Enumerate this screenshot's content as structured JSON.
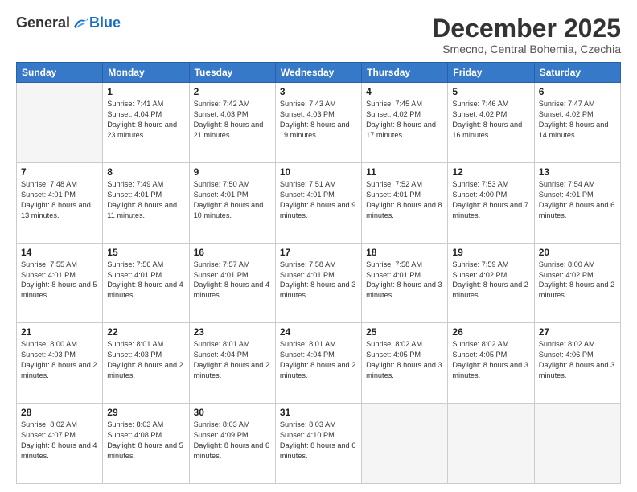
{
  "logo": {
    "general": "General",
    "blue": "Blue"
  },
  "title": {
    "month": "December 2025",
    "location": "Smecno, Central Bohemia, Czechia"
  },
  "weekdays": [
    "Sunday",
    "Monday",
    "Tuesday",
    "Wednesday",
    "Thursday",
    "Friday",
    "Saturday"
  ],
  "weeks": [
    [
      {
        "day": "",
        "sunrise": "",
        "sunset": "",
        "daylight": ""
      },
      {
        "day": "1",
        "sunrise": "Sunrise: 7:41 AM",
        "sunset": "Sunset: 4:04 PM",
        "daylight": "Daylight: 8 hours and 23 minutes."
      },
      {
        "day": "2",
        "sunrise": "Sunrise: 7:42 AM",
        "sunset": "Sunset: 4:03 PM",
        "daylight": "Daylight: 8 hours and 21 minutes."
      },
      {
        "day": "3",
        "sunrise": "Sunrise: 7:43 AM",
        "sunset": "Sunset: 4:03 PM",
        "daylight": "Daylight: 8 hours and 19 minutes."
      },
      {
        "day": "4",
        "sunrise": "Sunrise: 7:45 AM",
        "sunset": "Sunset: 4:02 PM",
        "daylight": "Daylight: 8 hours and 17 minutes."
      },
      {
        "day": "5",
        "sunrise": "Sunrise: 7:46 AM",
        "sunset": "Sunset: 4:02 PM",
        "daylight": "Daylight: 8 hours and 16 minutes."
      },
      {
        "day": "6",
        "sunrise": "Sunrise: 7:47 AM",
        "sunset": "Sunset: 4:02 PM",
        "daylight": "Daylight: 8 hours and 14 minutes."
      }
    ],
    [
      {
        "day": "7",
        "sunrise": "Sunrise: 7:48 AM",
        "sunset": "Sunset: 4:01 PM",
        "daylight": "Daylight: 8 hours and 13 minutes."
      },
      {
        "day": "8",
        "sunrise": "Sunrise: 7:49 AM",
        "sunset": "Sunset: 4:01 PM",
        "daylight": "Daylight: 8 hours and 11 minutes."
      },
      {
        "day": "9",
        "sunrise": "Sunrise: 7:50 AM",
        "sunset": "Sunset: 4:01 PM",
        "daylight": "Daylight: 8 hours and 10 minutes."
      },
      {
        "day": "10",
        "sunrise": "Sunrise: 7:51 AM",
        "sunset": "Sunset: 4:01 PM",
        "daylight": "Daylight: 8 hours and 9 minutes."
      },
      {
        "day": "11",
        "sunrise": "Sunrise: 7:52 AM",
        "sunset": "Sunset: 4:01 PM",
        "daylight": "Daylight: 8 hours and 8 minutes."
      },
      {
        "day": "12",
        "sunrise": "Sunrise: 7:53 AM",
        "sunset": "Sunset: 4:00 PM",
        "daylight": "Daylight: 8 hours and 7 minutes."
      },
      {
        "day": "13",
        "sunrise": "Sunrise: 7:54 AM",
        "sunset": "Sunset: 4:01 PM",
        "daylight": "Daylight: 8 hours and 6 minutes."
      }
    ],
    [
      {
        "day": "14",
        "sunrise": "Sunrise: 7:55 AM",
        "sunset": "Sunset: 4:01 PM",
        "daylight": "Daylight: 8 hours and 5 minutes."
      },
      {
        "day": "15",
        "sunrise": "Sunrise: 7:56 AM",
        "sunset": "Sunset: 4:01 PM",
        "daylight": "Daylight: 8 hours and 4 minutes."
      },
      {
        "day": "16",
        "sunrise": "Sunrise: 7:57 AM",
        "sunset": "Sunset: 4:01 PM",
        "daylight": "Daylight: 8 hours and 4 minutes."
      },
      {
        "day": "17",
        "sunrise": "Sunrise: 7:58 AM",
        "sunset": "Sunset: 4:01 PM",
        "daylight": "Daylight: 8 hours and 3 minutes."
      },
      {
        "day": "18",
        "sunrise": "Sunrise: 7:58 AM",
        "sunset": "Sunset: 4:01 PM",
        "daylight": "Daylight: 8 hours and 3 minutes."
      },
      {
        "day": "19",
        "sunrise": "Sunrise: 7:59 AM",
        "sunset": "Sunset: 4:02 PM",
        "daylight": "Daylight: 8 hours and 2 minutes."
      },
      {
        "day": "20",
        "sunrise": "Sunrise: 8:00 AM",
        "sunset": "Sunset: 4:02 PM",
        "daylight": "Daylight: 8 hours and 2 minutes."
      }
    ],
    [
      {
        "day": "21",
        "sunrise": "Sunrise: 8:00 AM",
        "sunset": "Sunset: 4:03 PM",
        "daylight": "Daylight: 8 hours and 2 minutes."
      },
      {
        "day": "22",
        "sunrise": "Sunrise: 8:01 AM",
        "sunset": "Sunset: 4:03 PM",
        "daylight": "Daylight: 8 hours and 2 minutes."
      },
      {
        "day": "23",
        "sunrise": "Sunrise: 8:01 AM",
        "sunset": "Sunset: 4:04 PM",
        "daylight": "Daylight: 8 hours and 2 minutes."
      },
      {
        "day": "24",
        "sunrise": "Sunrise: 8:01 AM",
        "sunset": "Sunset: 4:04 PM",
        "daylight": "Daylight: 8 hours and 2 minutes."
      },
      {
        "day": "25",
        "sunrise": "Sunrise: 8:02 AM",
        "sunset": "Sunset: 4:05 PM",
        "daylight": "Daylight: 8 hours and 3 minutes."
      },
      {
        "day": "26",
        "sunrise": "Sunrise: 8:02 AM",
        "sunset": "Sunset: 4:05 PM",
        "daylight": "Daylight: 8 hours and 3 minutes."
      },
      {
        "day": "27",
        "sunrise": "Sunrise: 8:02 AM",
        "sunset": "Sunset: 4:06 PM",
        "daylight": "Daylight: 8 hours and 3 minutes."
      }
    ],
    [
      {
        "day": "28",
        "sunrise": "Sunrise: 8:02 AM",
        "sunset": "Sunset: 4:07 PM",
        "daylight": "Daylight: 8 hours and 4 minutes."
      },
      {
        "day": "29",
        "sunrise": "Sunrise: 8:03 AM",
        "sunset": "Sunset: 4:08 PM",
        "daylight": "Daylight: 8 hours and 5 minutes."
      },
      {
        "day": "30",
        "sunrise": "Sunrise: 8:03 AM",
        "sunset": "Sunset: 4:09 PM",
        "daylight": "Daylight: 8 hours and 6 minutes."
      },
      {
        "day": "31",
        "sunrise": "Sunrise: 8:03 AM",
        "sunset": "Sunset: 4:10 PM",
        "daylight": "Daylight: 8 hours and 6 minutes."
      },
      {
        "day": "",
        "sunrise": "",
        "sunset": "",
        "daylight": ""
      },
      {
        "day": "",
        "sunrise": "",
        "sunset": "",
        "daylight": ""
      },
      {
        "day": "",
        "sunrise": "",
        "sunset": "",
        "daylight": ""
      }
    ]
  ]
}
